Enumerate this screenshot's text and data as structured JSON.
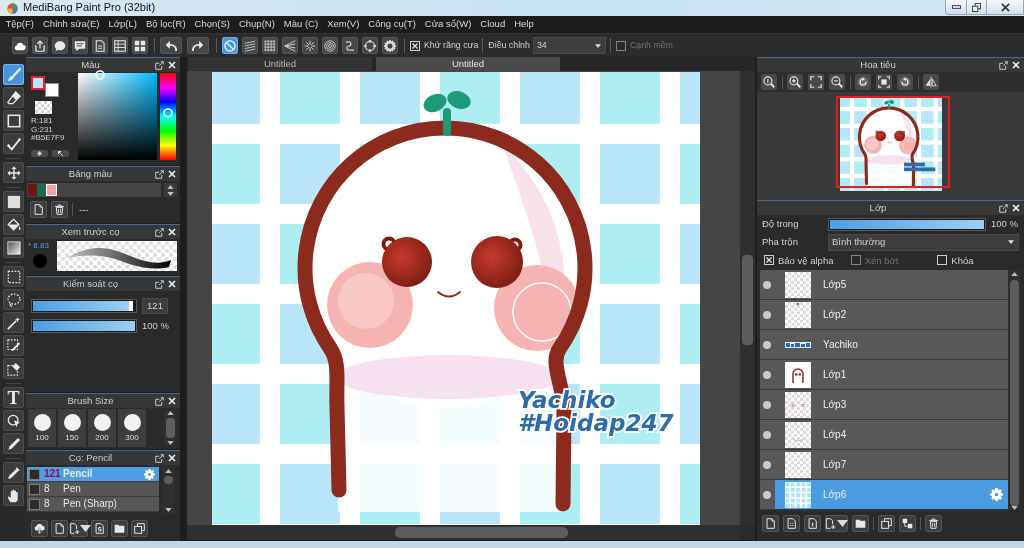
{
  "window": {
    "title": "MediBang Paint Pro (32bit)"
  },
  "menu": [
    "Tệp(F)",
    "Chỉnh sửa(E)",
    "Lớp(L)",
    "Bộ lọc(R)",
    "Chọn(S)",
    "Chụp(N)",
    "Màu (C)",
    "Xem(V)",
    "Công cụ(T)",
    "Cửa sổ(W)",
    "Cloud",
    "Help"
  ],
  "toolbar": {
    "snap_modes": [
      {
        "selected": true
      },
      {
        "selected": false
      },
      {
        "selected": false
      },
      {
        "selected": false
      },
      {
        "selected": false
      },
      {
        "selected": false
      },
      {
        "selected": false
      },
      {
        "selected": false
      }
    ],
    "antialias": {
      "label": "Khử răng cưa",
      "checked": true,
      "disabled": false
    },
    "adjust": {
      "label": "Điều chỉnh",
      "value": "34"
    },
    "soft_edge": {
      "label": "Cạnh mềm",
      "checked": false,
      "disabled": true
    }
  },
  "tools": [
    {
      "selected": true
    },
    {
      "selected": false
    },
    {
      "selected": false
    },
    {
      "selected": false
    },
    {
      "selected": false
    },
    {
      "selected": false
    },
    {
      "selected": false
    },
    {
      "selected": false
    },
    {
      "selected": false
    },
    {
      "selected": false
    },
    {
      "selected": false
    },
    {
      "selected": false
    },
    {
      "selected": false
    },
    {
      "selected": false,
      "glyph": "T"
    },
    {
      "selected": false
    },
    {
      "selected": false
    },
    {
      "selected": false
    },
    {
      "selected": false
    }
  ],
  "color_panel": {
    "title": "Màu",
    "swatches": [
      {
        "color": "#b5e7f9",
        "selected": true
      },
      {
        "color": "#ffffff",
        "selected": false
      }
    ],
    "readouts": [
      "R:181",
      "G:231",
      "#B5E7F9"
    ],
    "hue_slider": {
      "level": 0.544
    }
  },
  "palette": {
    "title": "Bảng màu",
    "swatches": [
      {
        "color": "#6e1515",
        "selected": false
      },
      {
        "color": "#1a6b50",
        "selected": false
      },
      {
        "color": "#f3a3a8",
        "selected": true
      }
    ],
    "name": "---"
  },
  "brush_preview": {
    "title": "Xem trước cọ",
    "size": "* 8.83"
  },
  "brush_control": {
    "title": "Kiểm soát cọ",
    "size": {
      "level": 0.98,
      "value": "121"
    },
    "opacity": {
      "level": 1,
      "reading": "100 %"
    }
  },
  "brush_size": {
    "title": "Brush Size",
    "sizes": [
      "100",
      "150",
      "200",
      "300"
    ]
  },
  "brushes": {
    "title": "Cọ: Pencil",
    "items": [
      {
        "size": "121",
        "name": "Pencil",
        "selected": true
      },
      {
        "size": "8",
        "name": "Pen",
        "selected": false
      },
      {
        "size": "8",
        "name": "Pen (Sharp)",
        "selected": false
      }
    ]
  },
  "canvas": {
    "tabs": [
      {
        "label": "Untitled",
        "selected": false
      },
      {
        "label": "Untitled",
        "selected": true
      }
    ],
    "signature": [
      "Yachiko",
      "#Hoidap247"
    ]
  },
  "navigator": {
    "title": "Hoa tiêu"
  },
  "layers": {
    "title": "Lớp",
    "opacity": {
      "label": "Độ trong",
      "level": 1,
      "reading": "100 %"
    },
    "blend": {
      "label": "Pha trộn",
      "value": "Bình thường"
    },
    "options": [
      {
        "label": "Bảo vệ alpha",
        "checked": true,
        "disabled": false
      },
      {
        "label": "Xén bớt",
        "checked": false,
        "disabled": true
      },
      {
        "label": "Khóa",
        "checked": false,
        "disabled": false
      }
    ],
    "items": [
      {
        "name": "Lớp5",
        "visible": true,
        "selected": false
      },
      {
        "name": "Lớp2",
        "visible": true,
        "selected": false
      },
      {
        "name": "Yachiko",
        "visible": true,
        "selected": false
      },
      {
        "name": "Lớp1",
        "visible": true,
        "selected": false
      },
      {
        "name": "Lớp3",
        "visible": true,
        "selected": false
      },
      {
        "name": "Lớp4",
        "visible": true,
        "selected": false
      },
      {
        "name": "Lớp7",
        "visible": true,
        "selected": false
      },
      {
        "name": "Lớp6",
        "visible": true,
        "selected": true
      }
    ]
  }
}
